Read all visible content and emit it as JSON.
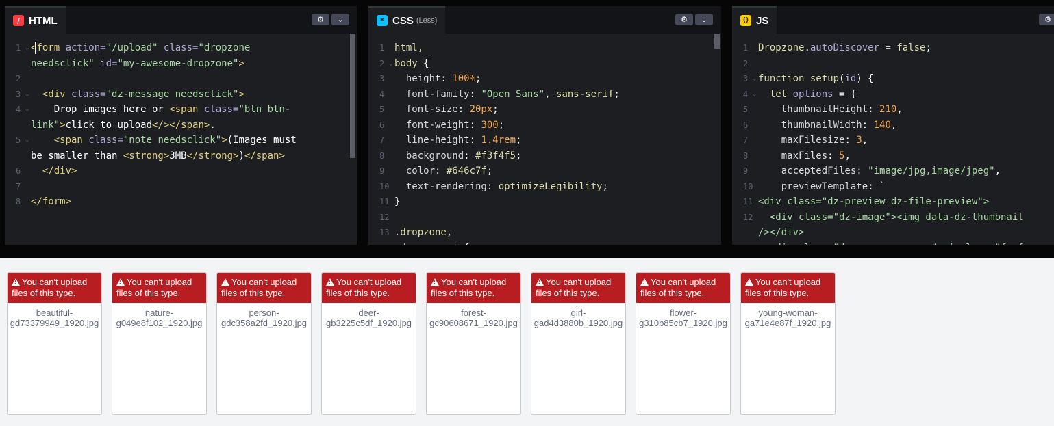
{
  "panes": {
    "html": {
      "title": "HTML",
      "subtitle": "",
      "icon": "html-icon",
      "icon_char": "/",
      "icon_color": "#ff3c41",
      "settings_icon": "⚙",
      "chevron_icon": "⌄",
      "lines": [
        {
          "n": "1",
          "fold": "⌄",
          "parts": [
            [
              "t-tag",
              "<form "
            ],
            [
              "t-attr",
              "action="
            ],
            [
              "t-str",
              "\"/upload\" "
            ],
            [
              "t-attr",
              "class="
            ],
            [
              "t-str",
              "\"dropzone"
            ]
          ]
        },
        {
          "n": "",
          "fold": "",
          "parts": [
            [
              "t-str",
              "needsclick\" "
            ],
            [
              "t-attr",
              "id="
            ],
            [
              "t-str",
              "\"my-awesome-dropzone\""
            ],
            [
              "t-tag",
              ">"
            ]
          ]
        },
        {
          "n": "2",
          "fold": "",
          "parts": []
        },
        {
          "n": "3",
          "fold": "⌄",
          "parts": [
            [
              "t-txt",
              "  "
            ],
            [
              "t-tag",
              "<div "
            ],
            [
              "t-attr",
              "class="
            ],
            [
              "t-str",
              "\"dz-message needsclick\""
            ],
            [
              "t-tag",
              ">"
            ]
          ]
        },
        {
          "n": "4",
          "fold": "⌄",
          "parts": [
            [
              "t-txt",
              "    Drop images here or "
            ],
            [
              "t-tag",
              "<span "
            ],
            [
              "t-attr",
              "class="
            ],
            [
              "t-str",
              "\"btn btn-"
            ]
          ]
        },
        {
          "n": "",
          "fold": "",
          "parts": [
            [
              "t-str",
              "link\""
            ],
            [
              "t-tag",
              ">"
            ],
            [
              "t-txt",
              "click to upload"
            ],
            [
              "t-tag",
              "</>"
            ],
            [
              "t-tag",
              "</span>"
            ],
            [
              "t-txt",
              "."
            ]
          ]
        },
        {
          "n": "5",
          "fold": "⌄",
          "parts": [
            [
              "t-txt",
              "    "
            ],
            [
              "t-tag",
              "<span "
            ],
            [
              "t-attr",
              "class="
            ],
            [
              "t-str",
              "\"note needsclick\""
            ],
            [
              "t-tag",
              ">"
            ],
            [
              "t-txt",
              "(Images must"
            ]
          ]
        },
        {
          "n": "",
          "fold": "",
          "parts": [
            [
              "t-txt",
              "be smaller than "
            ],
            [
              "t-tag",
              "<strong>"
            ],
            [
              "t-txt",
              "3MB"
            ],
            [
              "t-tag",
              "</strong>"
            ],
            [
              "t-txt",
              ")"
            ],
            [
              "t-tag",
              "</span>"
            ]
          ]
        },
        {
          "n": "6",
          "fold": "",
          "parts": [
            [
              "t-txt",
              "  "
            ],
            [
              "t-tag",
              "</div>"
            ]
          ]
        },
        {
          "n": "7",
          "fold": "",
          "parts": []
        },
        {
          "n": "8",
          "fold": "",
          "parts": [
            [
              "t-tag",
              "</form>"
            ]
          ]
        }
      ]
    },
    "css": {
      "title": "CSS",
      "subtitle": "(Less)",
      "icon": "css-icon",
      "icon_char": "*",
      "icon_color": "#0ebeff",
      "settings_icon": "⚙",
      "chevron_icon": "⌄",
      "lines": [
        {
          "n": "1",
          "fold": "",
          "parts": [
            [
              "t-kw",
              "html,"
            ]
          ]
        },
        {
          "n": "2",
          "fold": "⌄",
          "parts": [
            [
              "t-kw",
              "body "
            ],
            [
              "t-txt",
              "{"
            ]
          ]
        },
        {
          "n": "3",
          "fold": "",
          "parts": [
            [
              "t-txt",
              "  "
            ],
            [
              "t-prop",
              "height"
            ],
            [
              "t-txt",
              ": "
            ],
            [
              "t-num",
              "100%"
            ],
            [
              "t-txt",
              ";"
            ]
          ]
        },
        {
          "n": "4",
          "fold": "",
          "parts": [
            [
              "t-txt",
              "  "
            ],
            [
              "t-prop",
              "font-family"
            ],
            [
              "t-txt",
              ": "
            ],
            [
              "t-str",
              "\"Open Sans\""
            ],
            [
              "t-txt",
              ", "
            ],
            [
              "t-kw",
              "sans-serif"
            ],
            [
              "t-txt",
              ";"
            ]
          ]
        },
        {
          "n": "5",
          "fold": "",
          "parts": [
            [
              "t-txt",
              "  "
            ],
            [
              "t-prop",
              "font-size"
            ],
            [
              "t-txt",
              ": "
            ],
            [
              "t-num",
              "20px"
            ],
            [
              "t-txt",
              ";"
            ]
          ]
        },
        {
          "n": "6",
          "fold": "",
          "parts": [
            [
              "t-txt",
              "  "
            ],
            [
              "t-prop",
              "font-weight"
            ],
            [
              "t-txt",
              ": "
            ],
            [
              "t-num",
              "300"
            ],
            [
              "t-txt",
              ";"
            ]
          ]
        },
        {
          "n": "7",
          "fold": "",
          "parts": [
            [
              "t-txt",
              "  "
            ],
            [
              "t-prop",
              "line-height"
            ],
            [
              "t-txt",
              ": "
            ],
            [
              "t-num",
              "1.4rem"
            ],
            [
              "t-txt",
              ";"
            ]
          ]
        },
        {
          "n": "8",
          "fold": "",
          "parts": [
            [
              "t-txt",
              "  "
            ],
            [
              "t-prop",
              "background"
            ],
            [
              "t-txt",
              ": "
            ],
            [
              "t-kw",
              "#f3f4f5"
            ],
            [
              "t-txt",
              ";"
            ]
          ]
        },
        {
          "n": "9",
          "fold": "",
          "parts": [
            [
              "t-txt",
              "  "
            ],
            [
              "t-prop",
              "color"
            ],
            [
              "t-txt",
              ": "
            ],
            [
              "t-kw",
              "#646c7f"
            ],
            [
              "t-txt",
              ";"
            ]
          ]
        },
        {
          "n": "10",
          "fold": "",
          "parts": [
            [
              "t-txt",
              "  "
            ],
            [
              "t-prop",
              "text-rendering"
            ],
            [
              "t-txt",
              ": "
            ],
            [
              "t-kw",
              "optimizeLegibility"
            ],
            [
              "t-txt",
              ";"
            ]
          ]
        },
        {
          "n": "11",
          "fold": "",
          "parts": [
            [
              "t-txt",
              "}"
            ]
          ]
        },
        {
          "n": "12",
          "fold": "",
          "parts": []
        },
        {
          "n": "13",
          "fold": "",
          "parts": [
            [
              "t-kw",
              ".dropzone,"
            ]
          ]
        },
        {
          "n": "14",
          "fold": "⌄",
          "parts": [
            [
              "t-kw",
              ".dropzone * "
            ],
            [
              "t-txt",
              "{"
            ]
          ]
        }
      ]
    },
    "js": {
      "title": "JS",
      "subtitle": "",
      "icon": "js-icon",
      "icon_char": "()",
      "icon_color": "#fcd000",
      "settings_icon": "⚙",
      "chevron_icon": "⌄",
      "lines": [
        {
          "n": "1",
          "fold": "",
          "parts": [
            [
              "t-kw",
              "Dropzone"
            ],
            [
              "t-txt",
              "."
            ],
            [
              "t-attr",
              "autoDiscover"
            ],
            [
              "t-txt",
              " = "
            ],
            [
              "t-kw",
              "false"
            ],
            [
              "t-txt",
              ";"
            ]
          ]
        },
        {
          "n": "2",
          "fold": "",
          "parts": []
        },
        {
          "n": "3",
          "fold": "⌄",
          "parts": [
            [
              "t-kw",
              "function "
            ],
            [
              "t-kw",
              "setup"
            ],
            [
              "t-txt",
              "("
            ],
            [
              "t-attr",
              "id"
            ],
            [
              "t-txt",
              ") {"
            ]
          ]
        },
        {
          "n": "4",
          "fold": "⌄",
          "parts": [
            [
              "t-txt",
              "  "
            ],
            [
              "t-kw",
              "let "
            ],
            [
              "t-attr",
              "options"
            ],
            [
              "t-txt",
              " = {"
            ]
          ]
        },
        {
          "n": "5",
          "fold": "",
          "parts": [
            [
              "t-txt",
              "    "
            ],
            [
              "t-prop",
              "thumbnailHeight"
            ],
            [
              "t-txt",
              ": "
            ],
            [
              "t-num",
              "210"
            ],
            [
              "t-txt",
              ","
            ]
          ]
        },
        {
          "n": "6",
          "fold": "",
          "parts": [
            [
              "t-txt",
              "    "
            ],
            [
              "t-prop",
              "thumbnailWidth"
            ],
            [
              "t-txt",
              ": "
            ],
            [
              "t-num",
              "140"
            ],
            [
              "t-txt",
              ","
            ]
          ]
        },
        {
          "n": "7",
          "fold": "",
          "parts": [
            [
              "t-txt",
              "    "
            ],
            [
              "t-prop",
              "maxFilesize"
            ],
            [
              "t-txt",
              ": "
            ],
            [
              "t-num",
              "3"
            ],
            [
              "t-txt",
              ","
            ]
          ]
        },
        {
          "n": "8",
          "fold": "",
          "parts": [
            [
              "t-txt",
              "    "
            ],
            [
              "t-prop",
              "maxFiles"
            ],
            [
              "t-txt",
              ": "
            ],
            [
              "t-num",
              "5"
            ],
            [
              "t-txt",
              ","
            ]
          ]
        },
        {
          "n": "9",
          "fold": "",
          "parts": [
            [
              "t-txt",
              "    "
            ],
            [
              "t-prop",
              "acceptedFiles"
            ],
            [
              "t-txt",
              ": "
            ],
            [
              "t-str",
              "\"image/jpg,image/jpeg\""
            ],
            [
              "t-txt",
              ","
            ]
          ]
        },
        {
          "n": "10",
          "fold": "",
          "parts": [
            [
              "t-txt",
              "    "
            ],
            [
              "t-prop",
              "previewTemplate"
            ],
            [
              "t-txt",
              ": "
            ],
            [
              "t-str",
              "`"
            ]
          ]
        },
        {
          "n": "11",
          "fold": "",
          "parts": [
            [
              "t-str",
              "<div class=\"dz-preview dz-file-preview\">"
            ]
          ]
        },
        {
          "n": "12",
          "fold": "",
          "parts": [
            [
              "t-str",
              "  <div class=\"dz-image\"><img data-dz-thumbnail"
            ]
          ]
        },
        {
          "n": "",
          "fold": "",
          "parts": [
            [
              "t-str",
              "/></div>"
            ]
          ]
        },
        {
          "n": "13",
          "fold": "",
          "parts": [
            [
              "t-str",
              "  <div class=\"dz-error-message\"><i class=\"fa fa"
            ]
          ]
        }
      ]
    }
  },
  "previews": {
    "error_message": "You can't upload files of this type.",
    "warning_icon": "warning-icon",
    "files": [
      {
        "name": "beautiful-gd73379949_1920.jpg",
        "line1": "beautiful-",
        "line2": "gd73379949_1920.jpg"
      },
      {
        "name": "nature-g049e8f102_1920.jpg",
        "line1": "nature-",
        "line2": "g049e8f102_1920.jpg"
      },
      {
        "name": "person-gdc358a2fd_1920.jpg",
        "line1": "person-",
        "line2": "gdc358a2fd_1920.jpg"
      },
      {
        "name": "deer-gb3225c5df_1920.jpg",
        "line1": "deer-",
        "line2": "gb3225c5df_1920.jpg"
      },
      {
        "name": "forest-gc90608671_1920.jpg",
        "line1": "forest-",
        "line2": "gc90608671_1920.jpg"
      },
      {
        "name": "girl-gad4d3880b_1920.jpg",
        "line1": "girl-",
        "line2": "gad4d3880b_1920.jpg"
      },
      {
        "name": "flower-g310b85cb7_1920.jpg",
        "line1": "flower-",
        "line2": "g310b85cb7_1920.jpg"
      },
      {
        "name": "young-woman-ga71e4e87f_1920.jpg",
        "line1": "young-woman-",
        "line2": "ga71e4e87f_1920.jpg"
      }
    ]
  }
}
